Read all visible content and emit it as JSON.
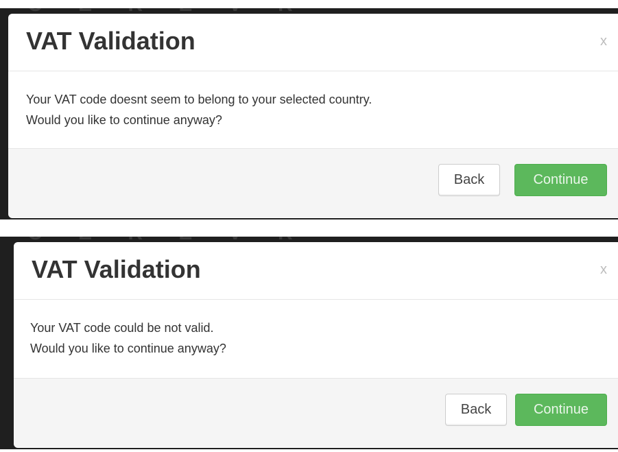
{
  "dialogs": [
    {
      "background_peek": "C E R E V R",
      "title": "VAT Validation",
      "close_label": "x",
      "message_line_1": "Your VAT code doesnt seem to belong to your selected country.",
      "message_line_2": "Would you like to continue anyway?",
      "back_label": "Back",
      "continue_label": "Continue"
    },
    {
      "background_peek": "C E R E V R",
      "title": "VAT Validation",
      "close_label": "x",
      "message_line_1": "Your VAT code could be not valid.",
      "message_line_2": "Would you like to continue anyway?",
      "back_label": "Back",
      "continue_label": "Continue"
    }
  ],
  "colors": {
    "continue_button": "#5cb85c",
    "footer_background": "#f5f5f5",
    "overlay_background": "#1f1f1f"
  }
}
